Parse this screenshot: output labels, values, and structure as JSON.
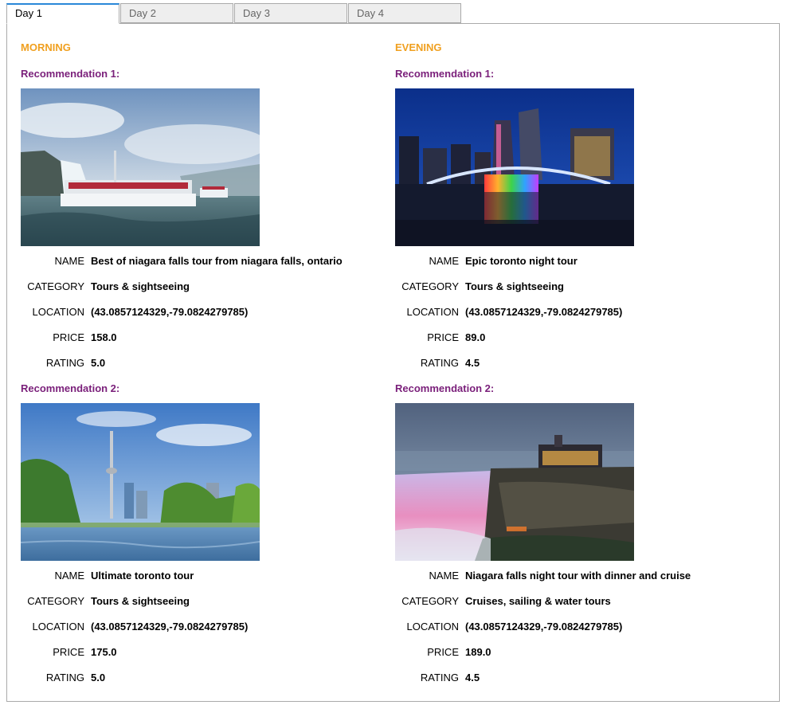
{
  "tabs": [
    "Day 1",
    "Day 2",
    "Day 3",
    "Day 4"
  ],
  "active_tab": 0,
  "field_labels": {
    "name": "NAME",
    "category": "CATEGORY",
    "location": "LOCATION",
    "price": "PRICE",
    "rating": "RATING"
  },
  "morning": {
    "heading": "MORNING",
    "recommendations": [
      {
        "title": "Recommendation 1:",
        "image": "niagara-boat-photo",
        "name": "Best of niagara falls tour from niagara falls, ontario",
        "category": "Tours & sightseeing",
        "location": "(43.0857124329,-79.0824279785)",
        "price": "158.0",
        "rating": "5.0"
      },
      {
        "title": "Recommendation 2:",
        "image": "toronto-cn-tower-photo",
        "name": "Ultimate toronto tour",
        "category": "Tours & sightseeing",
        "location": "(43.0857124329,-79.0824279785)",
        "price": "175.0",
        "rating": "5.0"
      }
    ]
  },
  "evening": {
    "heading": "EVENING",
    "recommendations": [
      {
        "title": "Recommendation 1:",
        "image": "toronto-night-sign-photo",
        "name": "Epic toronto night tour",
        "category": "Tours & sightseeing",
        "location": "(43.0857124329,-79.0824279785)",
        "price": "89.0",
        "rating": "4.5"
      },
      {
        "title": "Recommendation 2:",
        "image": "niagara-falls-night-photo",
        "name": "Niagara falls night tour with dinner and cruise",
        "category": "Cruises, sailing & water tours",
        "location": "(43.0857124329,-79.0824279785)",
        "price": "189.0",
        "rating": "4.5"
      }
    ]
  },
  "colors": {
    "period_heading": "#f0a020",
    "recommendation_title": "#7a1f7a",
    "active_tab_accent": "#2a88d8"
  }
}
